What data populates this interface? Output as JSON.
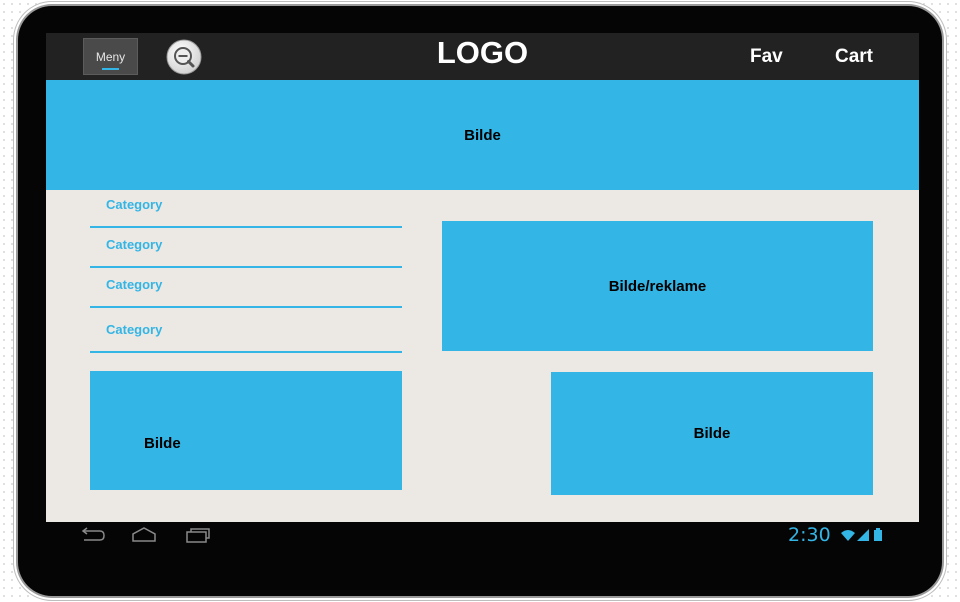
{
  "topbar": {
    "menu_label": "Meny",
    "logo_text": "LOGO",
    "fav_label": "Fav",
    "cart_label": "Cart",
    "search_icon": "zoom-out-magnifier-icon"
  },
  "hero": {
    "label": "Bilde"
  },
  "categories": [
    {
      "label": "Category"
    },
    {
      "label": "Category"
    },
    {
      "label": "Category"
    },
    {
      "label": "Category"
    }
  ],
  "ad": {
    "label": "Bilde/reklame"
  },
  "tiles": {
    "left_label": "Bilde",
    "right_label": "Bilde"
  },
  "system_bar": {
    "back_icon": "back-icon",
    "home_icon": "home-icon",
    "recents_icon": "recent-apps-icon",
    "time": "2:30",
    "wifi_icon": "wifi-icon",
    "signal_icon": "signal-icon",
    "battery_icon": "battery-icon"
  },
  "colors": {
    "accent": "#33b5e5",
    "screen_bg": "#ece8e3",
    "topbar_bg": "#222222",
    "bezel": "#050505"
  }
}
